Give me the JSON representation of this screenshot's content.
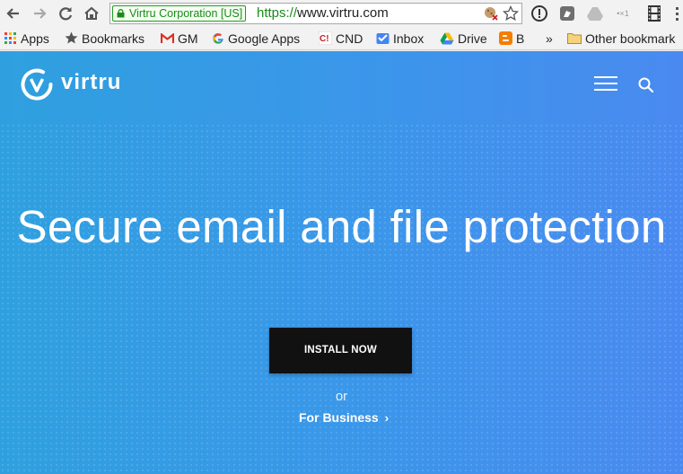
{
  "browser": {
    "omnibox": {
      "ev_label": "Virtru Corporation [US]",
      "url_scheme": "https://",
      "url_host": "www.virtru.com"
    },
    "bookmarks": [
      {
        "label": "Apps",
        "icon": "apps-grid-icon"
      },
      {
        "label": "Bookmarks",
        "icon": "star-icon"
      },
      {
        "label": "GM",
        "icon": "gmail-icon"
      },
      {
        "label": "Google Apps",
        "icon": "google-icon"
      },
      {
        "label": "CND",
        "icon": "cnd-icon"
      },
      {
        "label": "Inbox",
        "icon": "inbox-icon"
      },
      {
        "label": "Drive",
        "icon": "drive-icon"
      },
      {
        "label": "B",
        "icon": "blogger-icon"
      }
    ],
    "overflow": "»",
    "other_bookmarks": "Other bookmark"
  },
  "site": {
    "logo_text": "virtru",
    "hero_title": "Secure email and file protection",
    "install_label": "INSTALL NOW",
    "or_text": "or",
    "business_label": "For Business",
    "business_chevron": "›"
  },
  "colors": {
    "hero_left": "#2fa0df",
    "hero_right": "#4a8af0",
    "cta_bg": "#111111",
    "ev_green": "#1b8a1b"
  }
}
